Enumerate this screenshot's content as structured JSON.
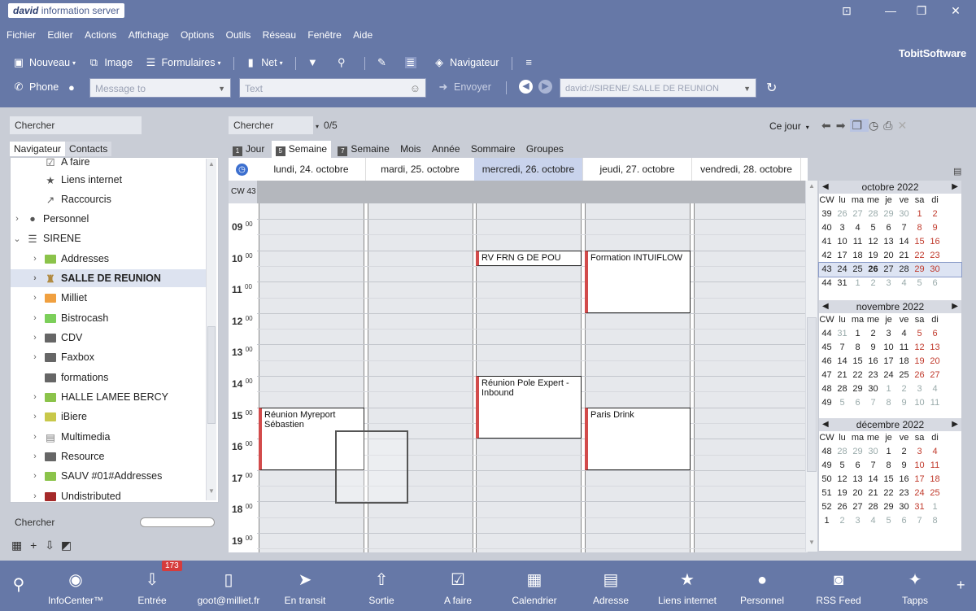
{
  "app": {
    "logo_brand": "david",
    "logo_text": "information server",
    "vendor": "TobitSoftware"
  },
  "window_controls": {
    "restore": "⊡",
    "minimize": "—",
    "maximize": "❐",
    "close": "✕"
  },
  "menu": [
    "Fichier",
    "Editer",
    "Actions",
    "Affichage",
    "Options",
    "Outils",
    "Réseau",
    "Fenêtre",
    "Aide"
  ],
  "toolbar1": {
    "nouveau": "Nouveau",
    "image": "Image",
    "formulaires": "Formulaires",
    "net": "Net",
    "navigateur": "Navigateur"
  },
  "toolbar2": {
    "phone": "Phone",
    "message_placeholder": "Message to",
    "text_placeholder": "Text",
    "send": "Envoyer",
    "address": "david://SIRENE/ SALLE DE REUNION"
  },
  "left": {
    "search_label": "Chercher",
    "tabs": [
      "Navigateur",
      "Contacts"
    ],
    "tree": [
      {
        "label": "A faire",
        "icon": "checkbox-icon",
        "color": "#555555"
      },
      {
        "label": "Liens internet",
        "icon": "star-icon",
        "color": "#555555"
      },
      {
        "label": "Raccourcis",
        "icon": "shortcut-icon",
        "color": "#555555"
      },
      {
        "label": "Personnel",
        "icon": "person-icon",
        "color": "#555555"
      },
      {
        "label": "SIRENE",
        "icon": "server-icon",
        "color": "#555555"
      },
      {
        "label": "Addresses",
        "icon": "folder-icon",
        "color": "#8bc34a"
      },
      {
        "label": "SALLE DE REUNION",
        "icon": "room-icon",
        "color": "#b0883c"
      },
      {
        "label": "Milliet",
        "icon": "folder-icon",
        "color": "#f0a040"
      },
      {
        "label": "Bistrocash",
        "icon": "folder-icon",
        "color": "#7ccf5a"
      },
      {
        "label": "CDV",
        "icon": "folder-icon",
        "color": "#666666"
      },
      {
        "label": "Faxbox",
        "icon": "folder-icon",
        "color": "#666666"
      },
      {
        "label": "formations",
        "icon": "folder-icon",
        "color": "#666666"
      },
      {
        "label": "HALLE LAMEE BERCY",
        "icon": "folder-icon",
        "color": "#8bc34a"
      },
      {
        "label": "iBiere",
        "icon": "folder-icon",
        "color": "#c8c84a"
      },
      {
        "label": "Multimedia",
        "icon": "media-icon",
        "color": "#777777"
      },
      {
        "label": "Resource",
        "icon": "folder-icon",
        "color": "#666666"
      },
      {
        "label": "SAUV #01#Addresses",
        "icon": "folder-icon",
        "color": "#8bc34a"
      },
      {
        "label": "Undistributed",
        "icon": "folder-icon",
        "color": "#a52a2a"
      }
    ],
    "bottom_search_label": "Chercher"
  },
  "calendar": {
    "search_label": "Chercher",
    "count": "0/5",
    "today_label": "Ce jour",
    "view_tabs": [
      "Jour",
      "Semaine",
      "Semaine",
      "Mois",
      "Année",
      "Sommaire",
      "Groupes"
    ],
    "week_label": "CW 43",
    "days": [
      "lundi, 24. octobre",
      "mardi, 25. octobre",
      "mercredi, 26. octobre",
      "jeudi, 27. octobre",
      "vendredi, 28. octobre"
    ],
    "hours": [
      "09",
      "10",
      "11",
      "12",
      "13",
      "14",
      "15",
      "16",
      "17",
      "18",
      "19"
    ],
    "minutes": "00",
    "appointments": [
      {
        "title": "RV FRN G DE POU",
        "day": 2,
        "start": 10.0,
        "end": 10.5
      },
      {
        "title": "Formation INTUIFLOW",
        "day": 3,
        "start": 10.0,
        "end": 12.0
      },
      {
        "title": "Réunion Pole Expert - Inbound",
        "day": 2,
        "start": 14.0,
        "end": 16.0
      },
      {
        "title": "Réunion Myreport Sébastien",
        "day": 0,
        "start": 15.0,
        "end": 17.0
      },
      {
        "title": "Paris Drink",
        "day": 3,
        "start": 15.0,
        "end": 17.0
      }
    ]
  },
  "mini_calendars": [
    {
      "title": "octobre 2022",
      "header": [
        "CW",
        "lu",
        "ma",
        "me",
        "je",
        "ve",
        "sa",
        "di"
      ],
      "weeks": [
        [
          "39",
          "26",
          "27",
          "28",
          "29",
          "30",
          "1",
          "2"
        ],
        [
          "40",
          "3",
          "4",
          "5",
          "6",
          "7",
          "8",
          "9"
        ],
        [
          "41",
          "10",
          "11",
          "12",
          "13",
          "14",
          "15",
          "16"
        ],
        [
          "42",
          "17",
          "18",
          "19",
          "20",
          "21",
          "22",
          "23"
        ],
        [
          "43",
          "24",
          "25",
          "26",
          "27",
          "28",
          "29",
          "30"
        ],
        [
          "44",
          "31",
          "1",
          "2",
          "3",
          "4",
          "5",
          "6"
        ]
      ]
    },
    {
      "title": "novembre 2022",
      "header": [
        "CW",
        "lu",
        "ma",
        "me",
        "je",
        "ve",
        "sa",
        "di"
      ],
      "weeks": [
        [
          "44",
          "31",
          "1",
          "2",
          "3",
          "4",
          "5",
          "6"
        ],
        [
          "45",
          "7",
          "8",
          "9",
          "10",
          "11",
          "12",
          "13"
        ],
        [
          "46",
          "14",
          "15",
          "16",
          "17",
          "18",
          "19",
          "20"
        ],
        [
          "47",
          "21",
          "22",
          "23",
          "24",
          "25",
          "26",
          "27"
        ],
        [
          "48",
          "28",
          "29",
          "30",
          "1",
          "2",
          "3",
          "4"
        ],
        [
          "49",
          "5",
          "6",
          "7",
          "8",
          "9",
          "10",
          "11"
        ]
      ]
    },
    {
      "title": "décembre 2022",
      "header": [
        "CW",
        "lu",
        "ma",
        "me",
        "je",
        "ve",
        "sa",
        "di"
      ],
      "weeks": [
        [
          "48",
          "28",
          "29",
          "30",
          "1",
          "2",
          "3",
          "4"
        ],
        [
          "49",
          "5",
          "6",
          "7",
          "8",
          "9",
          "10",
          "11"
        ],
        [
          "50",
          "12",
          "13",
          "14",
          "15",
          "16",
          "17",
          "18"
        ],
        [
          "51",
          "19",
          "20",
          "21",
          "22",
          "23",
          "24",
          "25"
        ],
        [
          "52",
          "26",
          "27",
          "28",
          "29",
          "30",
          "31",
          "1"
        ],
        [
          "1",
          "2",
          "3",
          "4",
          "5",
          "6",
          "7",
          "8"
        ]
      ]
    }
  ],
  "dock": {
    "badge": "173",
    "items": [
      {
        "label": "",
        "icon": "search-icon"
      },
      {
        "label": "InfoCenter™",
        "icon": "infocenter-icon"
      },
      {
        "label": "Entrée",
        "icon": "inbox-icon"
      },
      {
        "label": "goot@milliet.fr",
        "icon": "phone-icon"
      },
      {
        "label": "En transit",
        "icon": "paper-plane-icon"
      },
      {
        "label": "Sortie",
        "icon": "outbox-icon"
      },
      {
        "label": "A faire",
        "icon": "checkbox-icon"
      },
      {
        "label": "Calendrier",
        "icon": "calendar-icon"
      },
      {
        "label": "Adresse",
        "icon": "address-card-icon"
      },
      {
        "label": "Liens internet",
        "icon": "star-icon"
      },
      {
        "label": "Personnel",
        "icon": "person-icon"
      },
      {
        "label": "RSS Feed",
        "icon": "rss-icon"
      },
      {
        "label": "Tapps",
        "icon": "tapps-icon"
      }
    ]
  }
}
